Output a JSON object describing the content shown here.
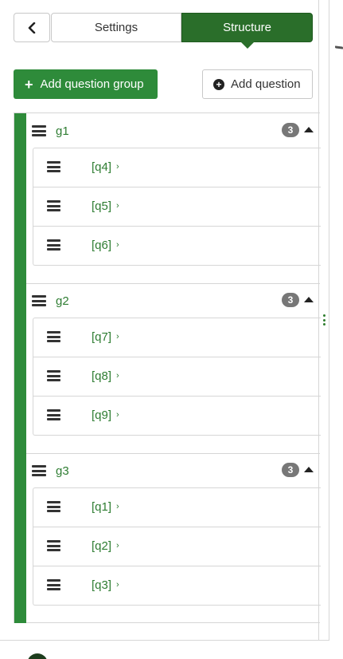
{
  "tabs": {
    "back_icon": "chevron-left-icon",
    "settings_label": "Settings",
    "structure_label": "Structure",
    "active": "Structure"
  },
  "actions": {
    "add_group_label": "Add question group",
    "add_question_label": "Add question"
  },
  "colors": {
    "accent": "#2e8b3a",
    "active_tab": "#2a6e2a",
    "link_text": "#2e7d32",
    "badge": "#777777"
  },
  "groups": [
    {
      "name": "g1",
      "count": "3",
      "questions": [
        {
          "code": "[q4]",
          "chevron": "›"
        },
        {
          "code": "[q5]",
          "chevron": "›"
        },
        {
          "code": "[q6]",
          "chevron": "›"
        }
      ]
    },
    {
      "name": "g2",
      "count": "3",
      "questions": [
        {
          "code": "[q7]",
          "chevron": "›"
        },
        {
          "code": "[q8]",
          "chevron": "›"
        },
        {
          "code": "[q9]",
          "chevron": "›"
        }
      ]
    },
    {
      "name": "g3",
      "count": "3",
      "questions": [
        {
          "code": "[q1]",
          "chevron": "›"
        },
        {
          "code": "[q2]",
          "chevron": "›"
        },
        {
          "code": "[q3]",
          "chevron": "›"
        }
      ]
    }
  ]
}
